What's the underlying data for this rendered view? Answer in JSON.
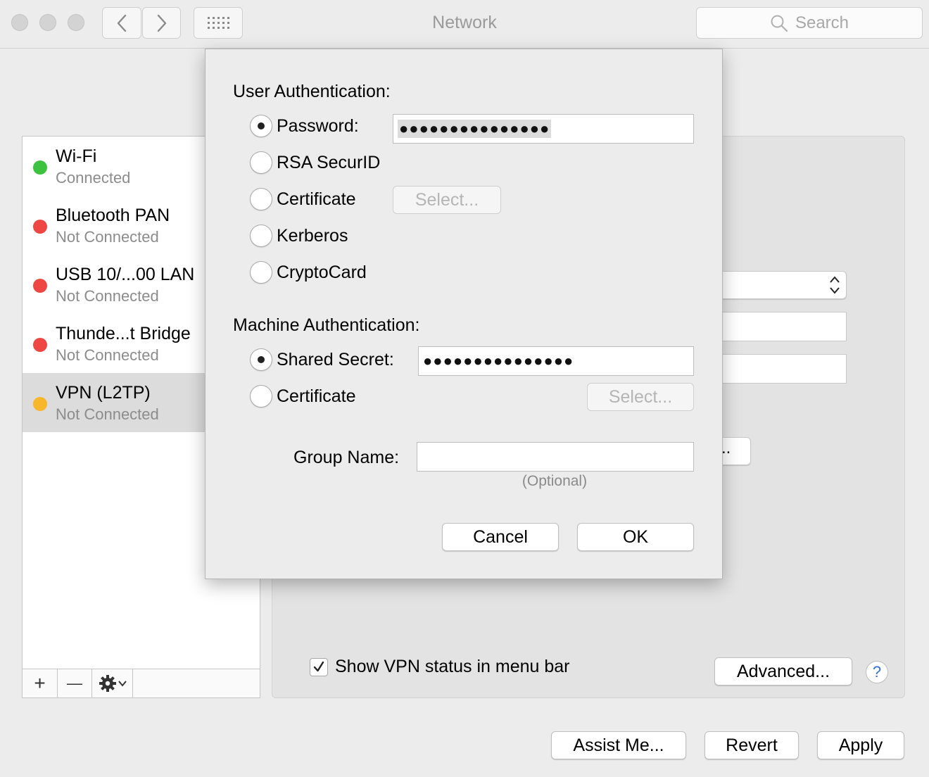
{
  "window": {
    "title": "Network",
    "search_placeholder": "Search"
  },
  "sidebar": {
    "services": [
      {
        "name": "Wi-Fi",
        "status": "Connected",
        "color": "#3cc23e"
      },
      {
        "name": "Bluetooth PAN",
        "status": "Not Connected",
        "color": "#ee4642"
      },
      {
        "name": "USB 10/...00 LAN",
        "status": "Not Connected",
        "color": "#ee4642"
      },
      {
        "name": "Thunde...t Bridge",
        "status": "Not Connected",
        "color": "#ee4642"
      },
      {
        "name": "VPN (L2TP)",
        "status": "Not Connected",
        "color": "#f7b62c"
      }
    ],
    "add_label": "+",
    "remove_label": "—"
  },
  "main": {
    "show_vpn_status_label": "Show VPN status in menu bar",
    "show_vpn_status_checked": true,
    "advanced_label": "Advanced...",
    "help_label": "?"
  },
  "footer": {
    "assist_label": "Assist Me...",
    "revert_label": "Revert",
    "apply_label": "Apply"
  },
  "sheet": {
    "user_auth_title": "User Authentication:",
    "user_auth_options": [
      {
        "label": "Password:",
        "checked": true
      },
      {
        "label": "RSA SecurID",
        "checked": false
      },
      {
        "label": "Certificate",
        "checked": false
      },
      {
        "label": "Kerberos",
        "checked": false
      },
      {
        "label": "CryptoCard",
        "checked": false
      }
    ],
    "password_value": "●●●●●●●●●●●●●●●",
    "cert_select_label": "Select...",
    "machine_auth_title": "Machine Authentication:",
    "machine_auth_options": [
      {
        "label": "Shared Secret:",
        "checked": true
      },
      {
        "label": "Certificate",
        "checked": false
      }
    ],
    "shared_secret_value": "●●●●●●●●●●●●●●●",
    "machine_cert_select_label": "Select...",
    "group_name_label": "Group Name:",
    "group_name_value": "",
    "group_name_hint": "(Optional)",
    "cancel_label": "Cancel",
    "ok_label": "OK"
  },
  "colors": {
    "accent": "#2f6fe4",
    "connected": "#3cc23e",
    "disconnected": "#ee4642",
    "inactive": "#f7b62c"
  }
}
